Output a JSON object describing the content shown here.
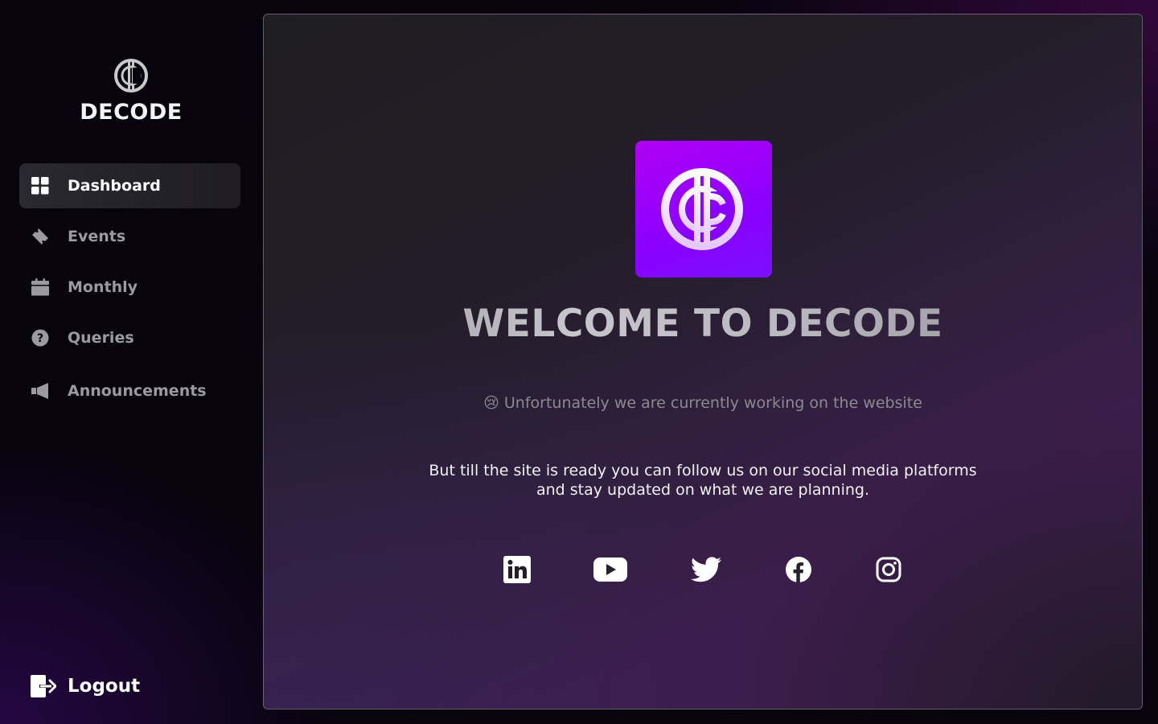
{
  "brand": {
    "name": "DECODE",
    "logo_icon": "decode-logo-icon"
  },
  "nav": {
    "items": [
      {
        "label": "Dashboard",
        "icon": "grid-icon",
        "active": true
      },
      {
        "label": "Events",
        "icon": "ticket-icon",
        "active": false
      },
      {
        "label": "Monthly",
        "icon": "calendar-icon",
        "active": false
      },
      {
        "label": "Queries",
        "icon": "question-circle-icon",
        "active": false
      },
      {
        "label": "Announcements",
        "icon": "megaphone-icon",
        "active": false
      }
    ]
  },
  "logout": {
    "label": "Logout",
    "icon": "logout-icon"
  },
  "main": {
    "title": "WELCOME TO DECODE",
    "status_emoji": "😢",
    "status_text": "Unfortunately we are currently working on the website",
    "message_line1": "But till the site is ready you can follow us on our social media platforms",
    "message_line2": "and stay updated on what we are planning.",
    "socials": [
      {
        "name": "LinkedIn",
        "icon": "linkedin-icon"
      },
      {
        "name": "YouTube",
        "icon": "youtube-icon"
      },
      {
        "name": "Twitter",
        "icon": "twitter-icon"
      },
      {
        "name": "Facebook",
        "icon": "facebook-icon"
      },
      {
        "name": "Instagram",
        "icon": "instagram-icon"
      }
    ]
  },
  "colors": {
    "accent": "#8a00ff",
    "accent_light": "#b100f5",
    "sidebar_bg": "#07040d",
    "nav_active_bg": "#2a2930",
    "nav_inactive_text": "#9b9aa1"
  }
}
